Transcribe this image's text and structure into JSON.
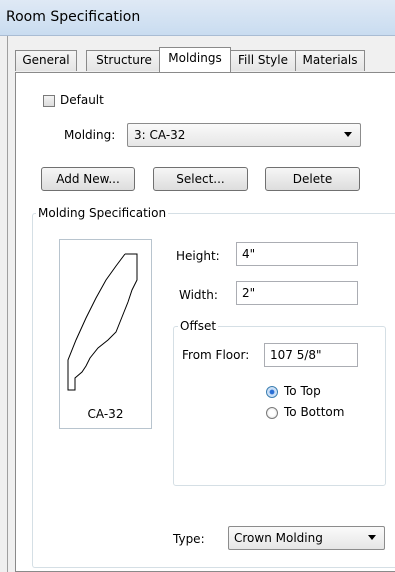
{
  "window": {
    "title": "Room Specification"
  },
  "tabs": [
    {
      "label": "General"
    },
    {
      "label": "Structure"
    },
    {
      "label": "Moldings"
    },
    {
      "label": "Fill Style"
    },
    {
      "label": "Materials"
    }
  ],
  "moldings": {
    "default_label": "Default",
    "default_checked": false,
    "molding_label": "Molding:",
    "molding_value": "3:  CA-32",
    "buttons": {
      "add_new": "Add New...",
      "select": "Select...",
      "delete": "Delete"
    },
    "spec": {
      "title": "Molding Specification",
      "preview_name": "CA-32",
      "height_label": "Height:",
      "height_value": "4\"",
      "width_label": "Width:",
      "width_value": "2\"",
      "offset": {
        "title": "Offset",
        "from_floor_label": "From Floor:",
        "from_floor_value": "107 5/8\"",
        "to_top_label": "To Top",
        "to_bottom_label": "To Bottom",
        "selected": "To Top"
      },
      "type_label": "Type:",
      "type_value": "Crown Molding"
    }
  }
}
